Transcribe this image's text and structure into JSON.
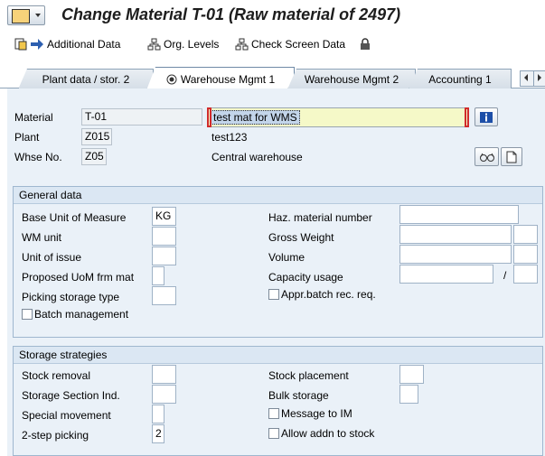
{
  "title": "Change Material T-01 (Raw material of 2497)",
  "toolbar": {
    "additional_data": "Additional Data",
    "org_levels": "Org. Levels",
    "check_screen_data": "Check Screen Data"
  },
  "tabs": [
    {
      "label": "Plant data / stor. 2",
      "active": false
    },
    {
      "label": "Warehouse Mgmt 1",
      "active": true
    },
    {
      "label": "Warehouse Mgmt 2",
      "active": false
    },
    {
      "label": "Accounting 1",
      "active": false
    }
  ],
  "header": {
    "material_label": "Material",
    "material_value": "T-01",
    "material_desc": "test mat for WMS",
    "plant_label": "Plant",
    "plant_value": "Z015",
    "plant_desc": "test123",
    "whse_label": "Whse No.",
    "whse_value": "Z05",
    "whse_desc": "Central warehouse"
  },
  "general": {
    "title": "General data",
    "base_uom_label": "Base Unit of Measure",
    "base_uom_value": "KG",
    "wm_unit_label": "WM unit",
    "wm_unit_value": "",
    "unit_issue_label": "Unit of issue",
    "unit_issue_value": "",
    "proposed_uom_label": "Proposed UoM frm mat",
    "picking_type_label": "Picking storage type",
    "batch_mgmt_label": "Batch management",
    "batch_mgmt_checked": false,
    "haz_label": "Haz. material number",
    "gross_weight_label": "Gross Weight",
    "volume_label": "Volume",
    "capacity_label": "Capacity usage",
    "capacity_sep": "/",
    "appr_batch_label": "Appr.batch rec. req.",
    "appr_batch_checked": false
  },
  "storage": {
    "title": "Storage strategies",
    "stock_removal_label": "Stock removal",
    "section_ind_label": "Storage Section Ind.",
    "special_movement_label": "Special movement",
    "two_step_label": "2-step picking",
    "two_step_value": "2",
    "stock_placement_label": "Stock placement",
    "bulk_storage_label": "Bulk storage",
    "message_im_label": "Message to IM",
    "message_im_checked": false,
    "allow_addn_label": "Allow addn to stock",
    "allow_addn_checked": false
  }
}
